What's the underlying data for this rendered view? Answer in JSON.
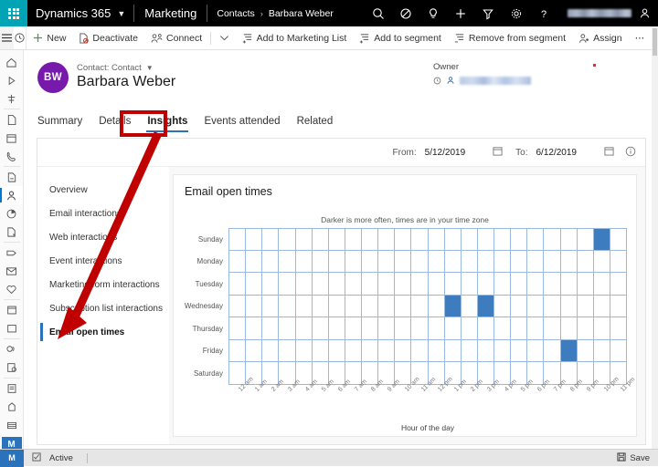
{
  "topbar": {
    "waffle": "app-launcher",
    "brand": "Dynamics 365",
    "app_name": "Marketing",
    "breadcrumb_parent": "Contacts",
    "breadcrumb_sep": "›",
    "breadcrumb_current": "Barbara Weber",
    "icons": [
      "search-icon",
      "focus-assist-icon",
      "lightbulb-icon",
      "plus-icon",
      "filter-icon",
      "settings-icon",
      "help-icon"
    ],
    "user_name_redacted": ""
  },
  "commandbar": {
    "hamburger": "site-map-icon",
    "recent": "recent-clock-icon",
    "items": [
      {
        "label": "New",
        "icon": "plus-icon"
      },
      {
        "label": "Deactivate",
        "icon": "deactivate-icon"
      },
      {
        "label": "Connect",
        "icon": "connect-icon"
      },
      {
        "label": "",
        "icon": "chevron-down-icon"
      },
      {
        "label": "Add to Marketing List",
        "icon": "add-to-list-icon"
      },
      {
        "label": "Add to segment",
        "icon": "add-to-segment-icon"
      },
      {
        "label": "Remove from segment",
        "icon": "remove-from-segment-icon"
      },
      {
        "label": "Assign",
        "icon": "assign-user-icon"
      },
      {
        "label": "⋯",
        "icon": "overflow-icon"
      }
    ]
  },
  "rail": {
    "items": [
      "home-icon",
      "recent-icon",
      "pinned-icon",
      "page-icon",
      "calendar-icon",
      "phone-icon",
      "accounts-icon",
      "contacts-icon",
      "segments-icon",
      "leads-icon",
      "marketing-email-icon",
      "email-icon",
      "social-post-icon",
      "customer-journey-icon",
      "event-icon",
      "marketing-page-icon",
      "form-icon",
      "survey-icon",
      "template-icon",
      "lead-score-icon",
      "library-icon"
    ],
    "selected_index": 7,
    "app_badge": "M"
  },
  "record": {
    "avatar_initials": "BW",
    "type_label": "Contact: Contact",
    "title": "Barbara Weber",
    "owner_label": "Owner",
    "owner_value_redacted": ""
  },
  "tabs": {
    "items": [
      "Summary",
      "Details",
      "Insights",
      "Events attended",
      "Related"
    ],
    "active": "Insights"
  },
  "daterange": {
    "from_label": "From:",
    "from_value": "5/12/2019",
    "to_label": "To:",
    "to_value": "6/12/2019",
    "calendar_icon": "calendar-icon",
    "info_icon": "info-icon"
  },
  "insights_nav": {
    "items": [
      "Overview",
      "Email interactions",
      "Web interactions",
      "Event interactions",
      "Marketing form interactions",
      "Subscription list interactions",
      "Email open times"
    ],
    "selected": "Email open times"
  },
  "statusbar": {
    "app_badge": "M",
    "lock_icon": "readonly-icon",
    "state": "Active",
    "save_label": "Save",
    "save_icon": "save-icon"
  },
  "annotations": {
    "highlight_target": "Insights",
    "arrow_from": "Insights tab",
    "arrow_to": "Email open times",
    "color": "#c00000"
  },
  "chart_data": {
    "type": "heatmap",
    "title": "Email open times",
    "subtitle": "Darker is more often, times are in your time zone",
    "xlabel": "Hour of the day",
    "ylabel": "",
    "categories_y": [
      "Sunday",
      "Monday",
      "Tuesday",
      "Wednesday",
      "Thursday",
      "Friday",
      "Saturday"
    ],
    "categories_x": [
      "12 am",
      "1 am",
      "2 am",
      "3 am",
      "4 am",
      "5 am",
      "6 am",
      "7 am",
      "8 am",
      "9 am",
      "10 am",
      "11 am",
      "12 pm",
      "1 pm",
      "2 pm",
      "3 pm",
      "4 pm",
      "5 pm",
      "6 pm",
      "7 pm",
      "8 pm",
      "9 pm",
      "10 pm",
      "11 pm"
    ],
    "colors": {
      "empty": "#ffffff",
      "filled": "#3d7cbf",
      "grid": "#9bb9e0"
    },
    "values": [
      [
        0,
        0,
        0,
        0,
        0,
        0,
        0,
        0,
        0,
        0,
        0,
        0,
        0,
        0,
        0,
        0,
        0,
        0,
        0,
        0,
        0,
        0,
        1,
        0
      ],
      [
        0,
        0,
        0,
        0,
        0,
        0,
        0,
        0,
        0,
        0,
        0,
        0,
        0,
        0,
        0,
        0,
        0,
        0,
        0,
        0,
        0,
        0,
        0,
        0
      ],
      [
        0,
        0,
        0,
        0,
        0,
        0,
        0,
        0,
        0,
        0,
        0,
        0,
        0,
        0,
        0,
        0,
        0,
        0,
        0,
        0,
        0,
        0,
        0,
        0
      ],
      [
        0,
        0,
        0,
        0,
        0,
        0,
        0,
        0,
        0,
        0,
        0,
        0,
        0,
        1,
        0,
        1,
        0,
        0,
        0,
        0,
        0,
        0,
        0,
        0
      ],
      [
        0,
        0,
        0,
        0,
        0,
        0,
        0,
        0,
        0,
        0,
        0,
        0,
        0,
        0,
        0,
        0,
        0,
        0,
        0,
        0,
        0,
        0,
        0,
        0
      ],
      [
        0,
        0,
        0,
        0,
        0,
        0,
        0,
        0,
        0,
        0,
        0,
        0,
        0,
        0,
        0,
        0,
        0,
        0,
        0,
        0,
        1,
        0,
        0,
        0
      ],
      [
        0,
        0,
        0,
        0,
        0,
        0,
        0,
        0,
        0,
        0,
        0,
        0,
        0,
        0,
        0,
        0,
        0,
        0,
        0,
        0,
        0,
        0,
        0,
        0
      ]
    ]
  }
}
